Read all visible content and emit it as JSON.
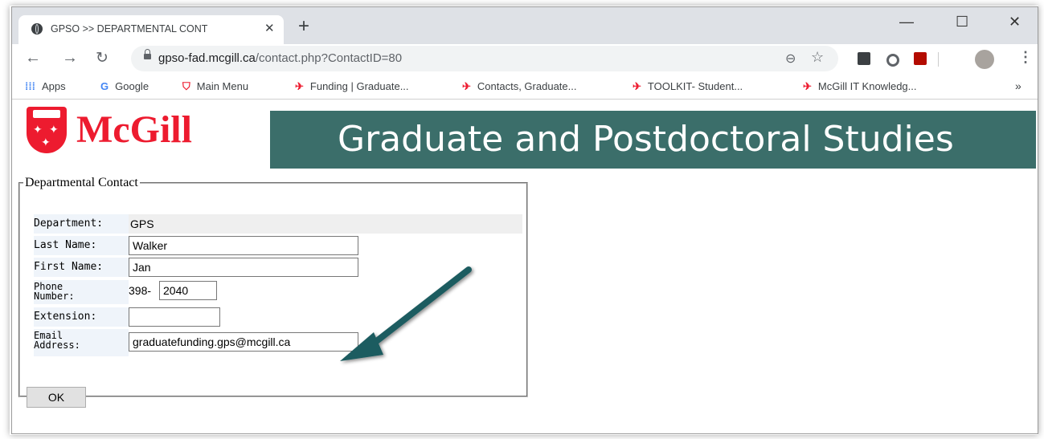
{
  "browser": {
    "tab_title": "GPSO >> DEPARTMENTAL CONT",
    "tab_close": "✕",
    "new_tab": "+",
    "minimize": "—",
    "maximize": "☐",
    "close": "✕",
    "url_host": "gpso-fad.mcgill.ca",
    "url_path": "/contact.php?ContactID=80"
  },
  "bookmarks": {
    "items": [
      {
        "label": "Apps",
        "icon": "apps-grid-icon"
      },
      {
        "label": "Google",
        "icon": "google-icon"
      },
      {
        "label": "Main Menu",
        "icon": "mcgill-shield-icon"
      },
      {
        "label": "Funding | Graduate...",
        "icon": "mcgill-bird-icon"
      },
      {
        "label": "Contacts, Graduate...",
        "icon": "mcgill-bird-icon"
      },
      {
        "label": "TOOLKIT- Student...",
        "icon": "mcgill-bird-icon"
      },
      {
        "label": "McGill IT Knowledg...",
        "icon": "mcgill-bird-icon"
      }
    ],
    "more": "»"
  },
  "header": {
    "logo_text": "McGill",
    "banner_text": "Graduate and Postdoctoral Studies"
  },
  "form": {
    "legend": "Departmental Contact",
    "department_label": "Department:",
    "department_value": "GPS",
    "last_name_label": "Last Name:",
    "last_name_value": "Walker",
    "first_name_label": "First Name:",
    "first_name_value": "Jan",
    "phone_label_1": "Phone",
    "phone_label_2": "Number:",
    "phone_prefix": "398-",
    "phone_value": "2040",
    "extension_label": "Extension:",
    "extension_value": "",
    "email_label_1": "Email",
    "email_label_2": "Address:",
    "email_value": "graduatefunding.gps@mcgill.ca",
    "ok_label": "OK"
  },
  "colors": {
    "mcgill_red": "#ed1b2f",
    "banner_bg": "#3b6e6a",
    "arrow": "#1f5c61"
  }
}
